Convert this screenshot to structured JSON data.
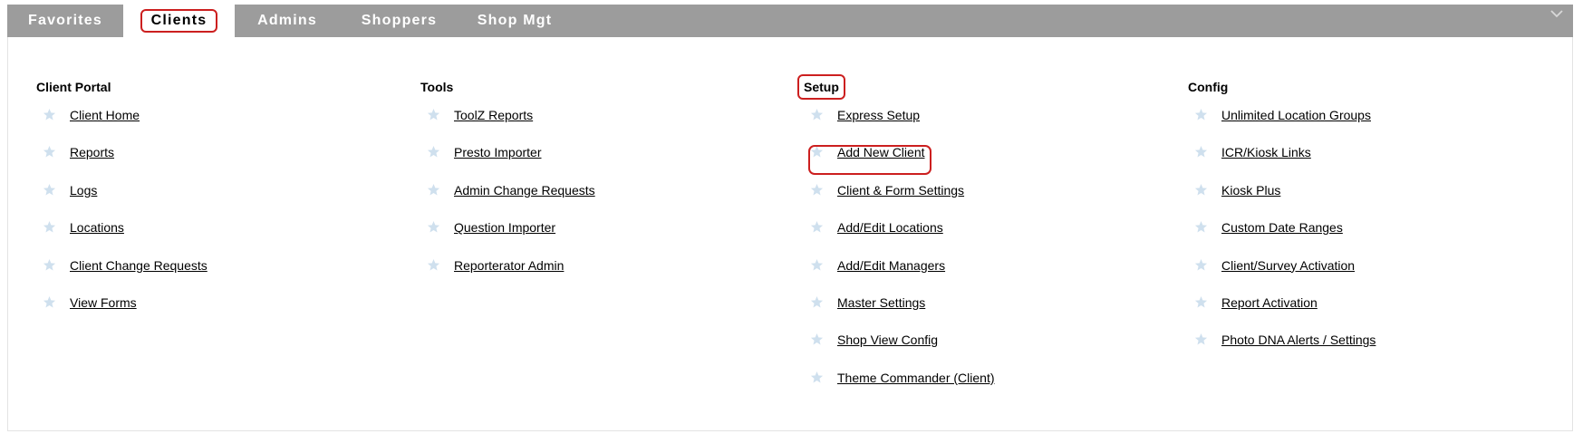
{
  "tabs": [
    {
      "label": "Favorites",
      "active": false
    },
    {
      "label": "Clients",
      "active": true
    },
    {
      "label": "Admins",
      "active": false
    },
    {
      "label": "Shoppers",
      "active": false
    },
    {
      "label": "Shop Mgt",
      "active": false
    }
  ],
  "columns": [
    {
      "heading": "Client Portal",
      "items": [
        "Client Home",
        "Reports",
        "Logs",
        "Locations",
        "Client Change Requests",
        "View Forms"
      ]
    },
    {
      "heading": "Tools",
      "items": [
        "ToolZ Reports",
        "Presto Importer",
        "Admin Change Requests",
        "Question Importer",
        "Reporterator Admin"
      ]
    },
    {
      "heading": "Setup",
      "items": [
        "Express Setup",
        "Add New Client",
        "Client & Form Settings",
        "Add/Edit Locations",
        "Add/Edit Managers",
        "Master Settings",
        "Shop View Config",
        "Theme Commander (Client)"
      ]
    },
    {
      "heading": "Config",
      "items": [
        "Unlimited Location Groups",
        "ICR/Kiosk Links",
        "Kiosk Plus",
        "Custom Date Ranges",
        "Client/Survey Activation",
        "Report Activation",
        "Photo DNA Alerts / Settings"
      ]
    }
  ],
  "icons": {
    "favorite": "star-icon",
    "collapse": "chevron-down-icon"
  },
  "colors": {
    "tabbar": "#9c9c9c",
    "star": "#cfe0ee",
    "highlight": "#cc1f1f"
  }
}
